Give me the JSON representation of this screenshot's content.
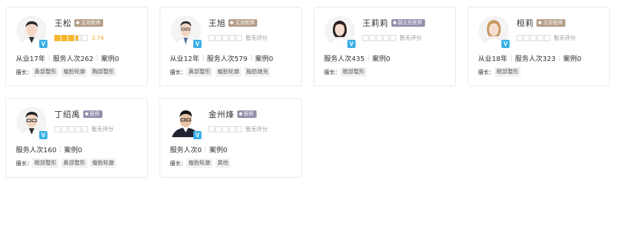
{
  "doctors": [
    {
      "name": "王松",
      "title": "主治医师",
      "title_color": "#b59f8a",
      "verified_badge": "V",
      "rating": {
        "stars": 3.5,
        "label": "3.74",
        "rated": true
      },
      "stats": [
        "从业17年",
        "服务人次262",
        "案例0"
      ],
      "skills_label": "擅长：",
      "skills": [
        "鼻部整形",
        "瘦脸轮廓",
        "胸部整形"
      ]
    },
    {
      "name": "王旭",
      "title": "主治医师",
      "title_color": "#b59f8a",
      "verified_badge": "V",
      "rating": {
        "stars": 0,
        "label": "暂无评分",
        "rated": false
      },
      "stats": [
        "从业12年",
        "服务人次579",
        "案例0"
      ],
      "skills_label": "擅长：",
      "skills": [
        "鼻部整形",
        "瘦脸轮廓",
        "脂肪填充"
      ]
    },
    {
      "name": "王莉莉",
      "title": "副主任医师",
      "title_color": "#9391ad",
      "verified_badge": "V",
      "rating": {
        "stars": 0,
        "label": "暂无评分",
        "rated": false
      },
      "stats": [
        "服务人次435",
        "案例0"
      ],
      "skills_label": "擅长：",
      "skills": [
        "眼部整形"
      ]
    },
    {
      "name": "桓莉",
      "title": "主治医师",
      "title_color": "#b59f8a",
      "verified_badge": "V",
      "rating": {
        "stars": 0,
        "label": "暂无评分",
        "rated": false
      },
      "stats": [
        "从业18年",
        "服务人次323",
        "案例0"
      ],
      "skills_label": "擅长：",
      "skills": [
        "眼部整形"
      ]
    },
    {
      "name": "丁绍禹",
      "title": "医师",
      "title_color": "#9391ad",
      "verified_badge": "V",
      "rating": {
        "stars": 0,
        "label": "暂无评分",
        "rated": false
      },
      "stats": [
        "服务人次160",
        "案例0"
      ],
      "skills_label": "擅长：",
      "skills": [
        "眼部整形",
        "鼻部整形",
        "瘦脸轮廓"
      ]
    },
    {
      "name": "金州烽",
      "title": "医师",
      "title_color": "#9391ad",
      "verified_badge": "V",
      "rating": {
        "stars": 0,
        "label": "暂无评分",
        "rated": false
      },
      "stats": [
        "服务人次0",
        "案例0"
      ],
      "skills_label": "擅长：",
      "skills": [
        "瘦脸轮廓",
        "其他"
      ]
    }
  ]
}
